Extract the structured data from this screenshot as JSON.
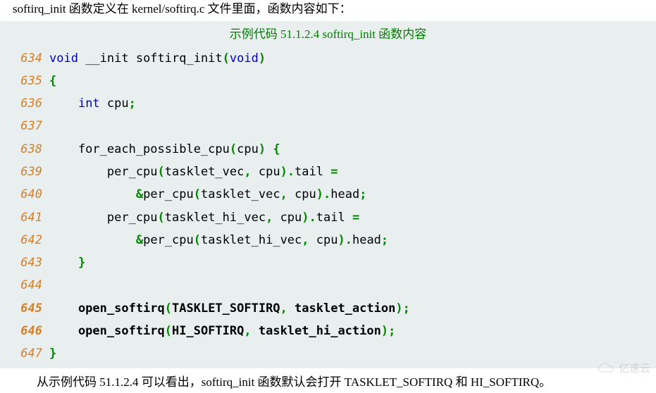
{
  "intro": "softirq_init 函数定义在 kernel/softirq.c 文件里面，函数内容如下：",
  "caption": "示例代码 51.1.2.4 softirq_init 函数内容",
  "code": {
    "lines": [
      {
        "n": "634",
        "bold": false,
        "tokens": [
          {
            "t": "void",
            "c": "kw"
          },
          {
            "t": " __init softirq_init"
          },
          {
            "t": "(",
            "c": "pn"
          },
          {
            "t": "void",
            "c": "kw"
          },
          {
            "t": ")",
            "c": "pn"
          }
        ]
      },
      {
        "n": "635",
        "bold": false,
        "tokens": [
          {
            "t": "{",
            "c": "pn"
          }
        ]
      },
      {
        "n": "636",
        "bold": false,
        "tokens": [
          {
            "t": "    "
          },
          {
            "t": "int",
            "c": "kw"
          },
          {
            "t": " cpu"
          },
          {
            "t": ";",
            "c": "pn"
          }
        ]
      },
      {
        "n": "637",
        "bold": false,
        "tokens": []
      },
      {
        "n": "638",
        "bold": false,
        "tokens": [
          {
            "t": "    for_each_possible_cpu"
          },
          {
            "t": "(",
            "c": "pn"
          },
          {
            "t": "cpu"
          },
          {
            "t": ")",
            "c": "pn"
          },
          {
            "t": " "
          },
          {
            "t": "{",
            "c": "pn"
          }
        ]
      },
      {
        "n": "639",
        "bold": false,
        "tokens": [
          {
            "t": "        per_cpu"
          },
          {
            "t": "(",
            "c": "pn"
          },
          {
            "t": "tasklet_vec"
          },
          {
            "t": ",",
            "c": "pn"
          },
          {
            "t": " cpu"
          },
          {
            "t": ").",
            "c": "pn"
          },
          {
            "t": "tail "
          },
          {
            "t": "=",
            "c": "pn"
          }
        ]
      },
      {
        "n": "640",
        "bold": false,
        "tokens": [
          {
            "t": "            "
          },
          {
            "t": "&",
            "c": "pn"
          },
          {
            "t": "per_cpu"
          },
          {
            "t": "(",
            "c": "pn"
          },
          {
            "t": "tasklet_vec"
          },
          {
            "t": ",",
            "c": "pn"
          },
          {
            "t": " cpu"
          },
          {
            "t": ").",
            "c": "pn"
          },
          {
            "t": "head"
          },
          {
            "t": ";",
            "c": "pn"
          }
        ]
      },
      {
        "n": "641",
        "bold": false,
        "tokens": [
          {
            "t": "        per_cpu"
          },
          {
            "t": "(",
            "c": "pn"
          },
          {
            "t": "tasklet_hi_vec"
          },
          {
            "t": ",",
            "c": "pn"
          },
          {
            "t": " cpu"
          },
          {
            "t": ").",
            "c": "pn"
          },
          {
            "t": "tail "
          },
          {
            "t": "=",
            "c": "pn"
          }
        ]
      },
      {
        "n": "642",
        "bold": false,
        "tokens": [
          {
            "t": "            "
          },
          {
            "t": "&",
            "c": "pn"
          },
          {
            "t": "per_cpu"
          },
          {
            "t": "(",
            "c": "pn"
          },
          {
            "t": "tasklet_hi_vec"
          },
          {
            "t": ",",
            "c": "pn"
          },
          {
            "t": " cpu"
          },
          {
            "t": ").",
            "c": "pn"
          },
          {
            "t": "head"
          },
          {
            "t": ";",
            "c": "pn"
          }
        ]
      },
      {
        "n": "643",
        "bold": false,
        "tokens": [
          {
            "t": "    "
          },
          {
            "t": "}",
            "c": "pn"
          }
        ]
      },
      {
        "n": "644",
        "bold": false,
        "tokens": []
      },
      {
        "n": "645",
        "bold": true,
        "tokens": [
          {
            "t": "    open_softirq"
          },
          {
            "t": "(",
            "c": "pn"
          },
          {
            "t": "TASKLET_SOFTIRQ"
          },
          {
            "t": ",",
            "c": "pn"
          },
          {
            "t": " tasklet_action"
          },
          {
            "t": ");",
            "c": "pn"
          }
        ]
      },
      {
        "n": "646",
        "bold": true,
        "tokens": [
          {
            "t": "    open_softirq"
          },
          {
            "t": "(",
            "c": "pn"
          },
          {
            "t": "HI_SOFTIRQ"
          },
          {
            "t": ",",
            "c": "pn"
          },
          {
            "t": " tasklet_hi_action"
          },
          {
            "t": ");",
            "c": "pn"
          }
        ]
      },
      {
        "n": "647",
        "bold": false,
        "tokens": [
          {
            "t": "}",
            "c": "pn"
          }
        ]
      }
    ]
  },
  "outro": "从示例代码 51.1.2.4 可以看出，softirq_init 函数默认会打开 TASKLET_SOFTIRQ 和 HI_SOFTIRQ。",
  "watermark": "亿速云"
}
